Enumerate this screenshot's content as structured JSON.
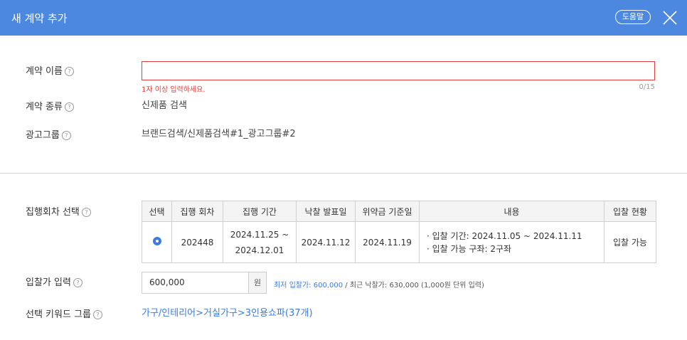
{
  "header": {
    "title": "새 계약 추가",
    "help_label": "도움말"
  },
  "form": {
    "contract_name_label": "계약 이름",
    "contract_name_value": "",
    "contract_name_error": "1자 이상 입력하세요.",
    "contract_name_count": "0/15",
    "contract_type_label": "계약 종류",
    "contract_type_value": "신제품 검색",
    "ad_group_label": "광고그룹",
    "ad_group_value": "브랜드검색/신제품검색#1_광고그룹#2",
    "round_label": "집행회차 선택",
    "bid_label": "입찰가 입력",
    "bid_value": "600,000",
    "bid_unit": "원",
    "bid_info_prefix": "최저 입찰가: 600,000",
    "bid_info_suffix": " / 최근 낙찰가: 630,000 (1,000원 단위 입력)",
    "keyword_label": "선택 키워드 그룹",
    "keyword_value": "가구/인테리어>거실가구>3인용쇼파(37개)"
  },
  "rounds_table": {
    "headers": [
      "선택",
      "집행 회차",
      "집행 기간",
      "낙찰 발표일",
      "위약금 기준일",
      "내용",
      "입찰 현황"
    ],
    "rows": [
      {
        "selected": true,
        "round": "202448",
        "period_start": "2024.11.25 ~",
        "period_end": "2024.12.01",
        "announce_date": "2024.11.12",
        "penalty_date": "2024.11.19",
        "content_line1": "· 입찰 기간: 2024.11.05 ~ 2024.11.11",
        "content_line2": "· 입찰 가능 구좌: 2구좌",
        "status": "입찰 가능"
      }
    ]
  },
  "colors": {
    "header_bg": "#4c88e0",
    "error": "#e63d3d",
    "link": "#3d7be0"
  }
}
